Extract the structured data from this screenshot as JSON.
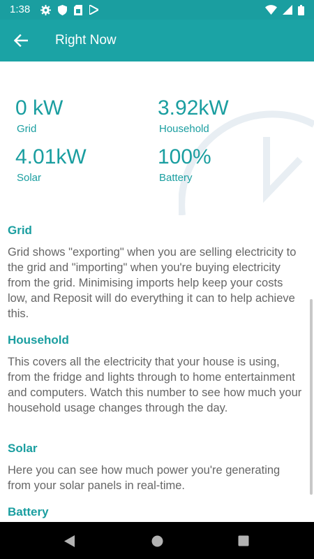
{
  "status_bar": {
    "time": "1:38",
    "left_icons": [
      "gear-icon",
      "shield-icon",
      "sim-card-icon",
      "play-store-icon"
    ],
    "right_icons": [
      "wifi-icon",
      "signal-icon",
      "battery-icon"
    ]
  },
  "app_bar": {
    "title": "Right Now",
    "back_icon": "arrow-back-icon"
  },
  "stats": {
    "grid": {
      "value": "0 kW",
      "label": "Grid"
    },
    "household": {
      "value": "3.92kW",
      "label": "Household"
    },
    "solar": {
      "value": "4.01kW",
      "label": "Solar"
    },
    "battery": {
      "value": "100%",
      "label": "Battery"
    }
  },
  "sections": [
    {
      "heading": "Grid",
      "body": "Grid shows \"exporting\" when you are selling electricity to the grid and \"importing\" when you're buying electricity from the grid. Minimising imports help keep your costs low, and Reposit will do everything it can to help achieve this."
    },
    {
      "heading": "Household",
      "body": "This covers all the electricity that your house is using, from the fridge and lights through to home entertainment and computers. Watch this number to see how much your household usage changes through the day."
    },
    {
      "heading": "Solar",
      "body": "Here you can see how much power you're generating from your solar panels in real-time."
    },
    {
      "heading": "Battery",
      "body": ""
    }
  ],
  "nav_bar": {
    "icons": [
      "nav-back-icon",
      "nav-home-icon",
      "nav-recents-icon"
    ]
  },
  "colors": {
    "primary": "#1ba3a5",
    "status_bar": "#1a9ea0",
    "accent_text": "#1a9ea0",
    "body_text": "#666666"
  }
}
